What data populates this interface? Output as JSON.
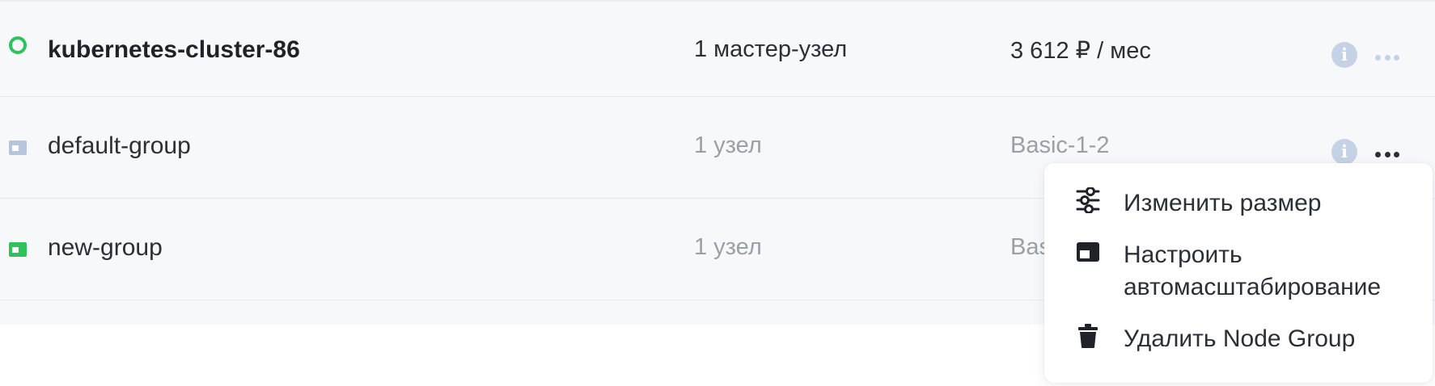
{
  "cluster": {
    "name": "kubernetes-cluster-86",
    "nodes": "1 мастер-узел",
    "price": "3 612 ₽ / мес",
    "status_color": "#2ec25b"
  },
  "groups": [
    {
      "name": "default-group",
      "nodes": "1 узел",
      "flavor": "Basic-1-2",
      "icon_color": "#b6c4dc"
    },
    {
      "name": "new-group",
      "nodes": "1 узел",
      "flavor": "Bas",
      "icon_color": "#2ec25b"
    }
  ],
  "context_menu": {
    "items": [
      {
        "label": "Изменить размер",
        "icon": "sliders-icon"
      },
      {
        "label": "Настроить\nавтомасштабирование",
        "icon": "autoscale-icon"
      },
      {
        "label": "Удалить Node Group",
        "icon": "trash-icon"
      }
    ]
  },
  "icons": {
    "info": "info-icon",
    "more": "more-options-icon"
  }
}
